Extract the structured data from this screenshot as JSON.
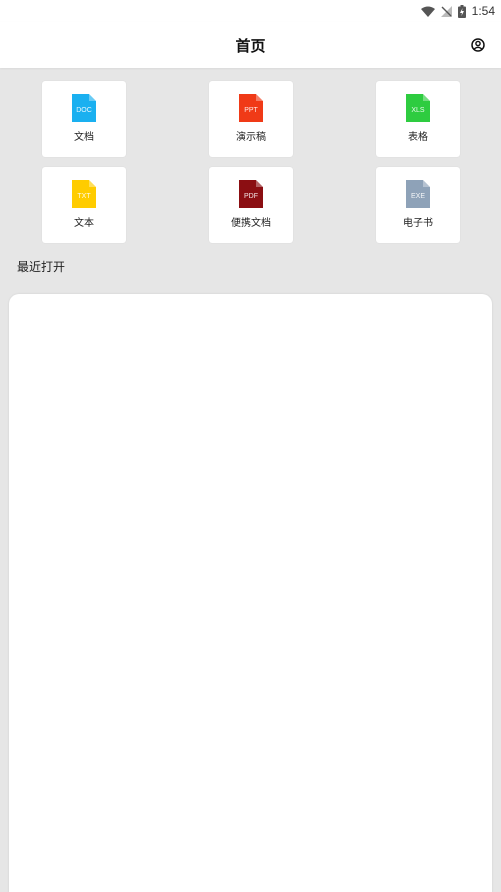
{
  "status_bar": {
    "time": "1:54",
    "icons": [
      "wifi-icon",
      "no-signal-icon",
      "battery-charging-icon"
    ]
  },
  "app_bar": {
    "title": "首页",
    "account_icon": "account-circle-icon"
  },
  "file_types": [
    {
      "label": "文档",
      "ext": "DOC",
      "color": "#1ab0f0"
    },
    {
      "label": "演示稿",
      "ext": "PPT",
      "color": "#f03a17"
    },
    {
      "label": "表格",
      "ext": "XLS",
      "color": "#2ecc40"
    },
    {
      "label": "文本",
      "ext": "TXT",
      "color": "#ffcc00"
    },
    {
      "label": "便携文档",
      "ext": "PDF",
      "color": "#8b0e12"
    },
    {
      "label": "电子书",
      "ext": "EXE",
      "color": "#8ea2b8"
    }
  ],
  "recent": {
    "title": "最近打开"
  }
}
